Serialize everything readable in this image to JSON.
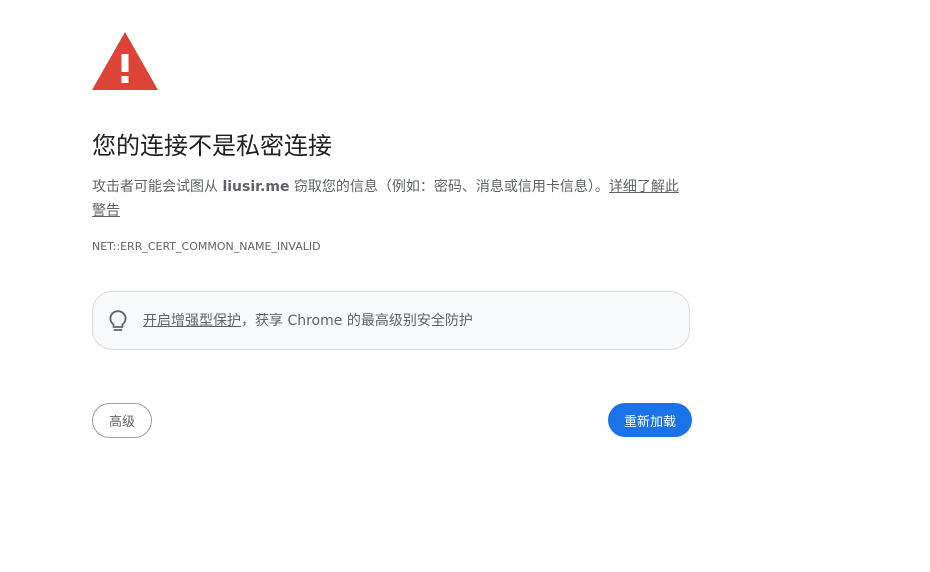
{
  "warning": {
    "icon": "warning-triangle-icon",
    "color": "#db4437"
  },
  "title": "您的连接不是私密连接",
  "message": {
    "prefix": "攻击者可能会试图从 ",
    "domain": "liusir.me",
    "suffix": " 窃取您的信息（例如：密码、消息或信用卡信息）。",
    "learn_more": "详细了解此警告"
  },
  "error_code": "NET::ERR_CERT_COMMON_NAME_INVALID",
  "promo": {
    "icon": "lightbulb-icon",
    "link_text": "开启增强型保护",
    "rest_text": "，获享 Chrome 的最高级别安全防护"
  },
  "buttons": {
    "advanced_label": "高级",
    "reload_label": "重新加载"
  },
  "colors": {
    "primary": "#1a73e8",
    "text": "#202124",
    "secondary_text": "#5f6368"
  }
}
